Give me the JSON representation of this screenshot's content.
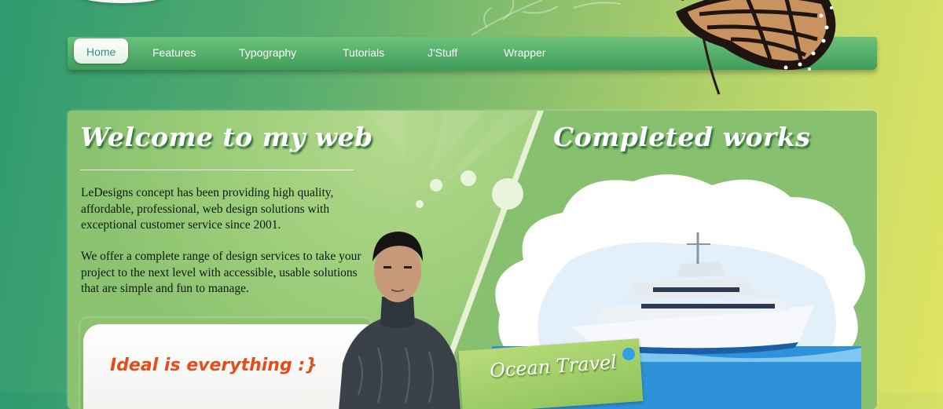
{
  "nav": {
    "items": [
      {
        "label": "Home",
        "active": true
      },
      {
        "label": "Features"
      },
      {
        "label": "Typography"
      },
      {
        "label": "Tutorials"
      },
      {
        "label": "J'Stuff"
      },
      {
        "label": "Wrapper"
      }
    ]
  },
  "welcome": {
    "title": "Welcome to my web",
    "para1": "LeDesigns concept  has been providing high quality, affordable, professional, web design solutions with exceptional customer service since 2001.",
    "para2": "We offer a complete range of design services to take your project to the next level with accessible, usable solutions that are simple and fun to manage."
  },
  "ideal": {
    "text": "Ideal is everything :}"
  },
  "works": {
    "title": "Completed works",
    "caption": "Ocean Travel"
  },
  "icons": [
    "butterfly-icon",
    "person-photo",
    "yacht-image",
    "leaves-decoration"
  ],
  "colors": {
    "nav": "#4fab63",
    "panel": "#87c06e",
    "accent": "#e34d1c",
    "active_tab_text": "#3b8c8a"
  }
}
